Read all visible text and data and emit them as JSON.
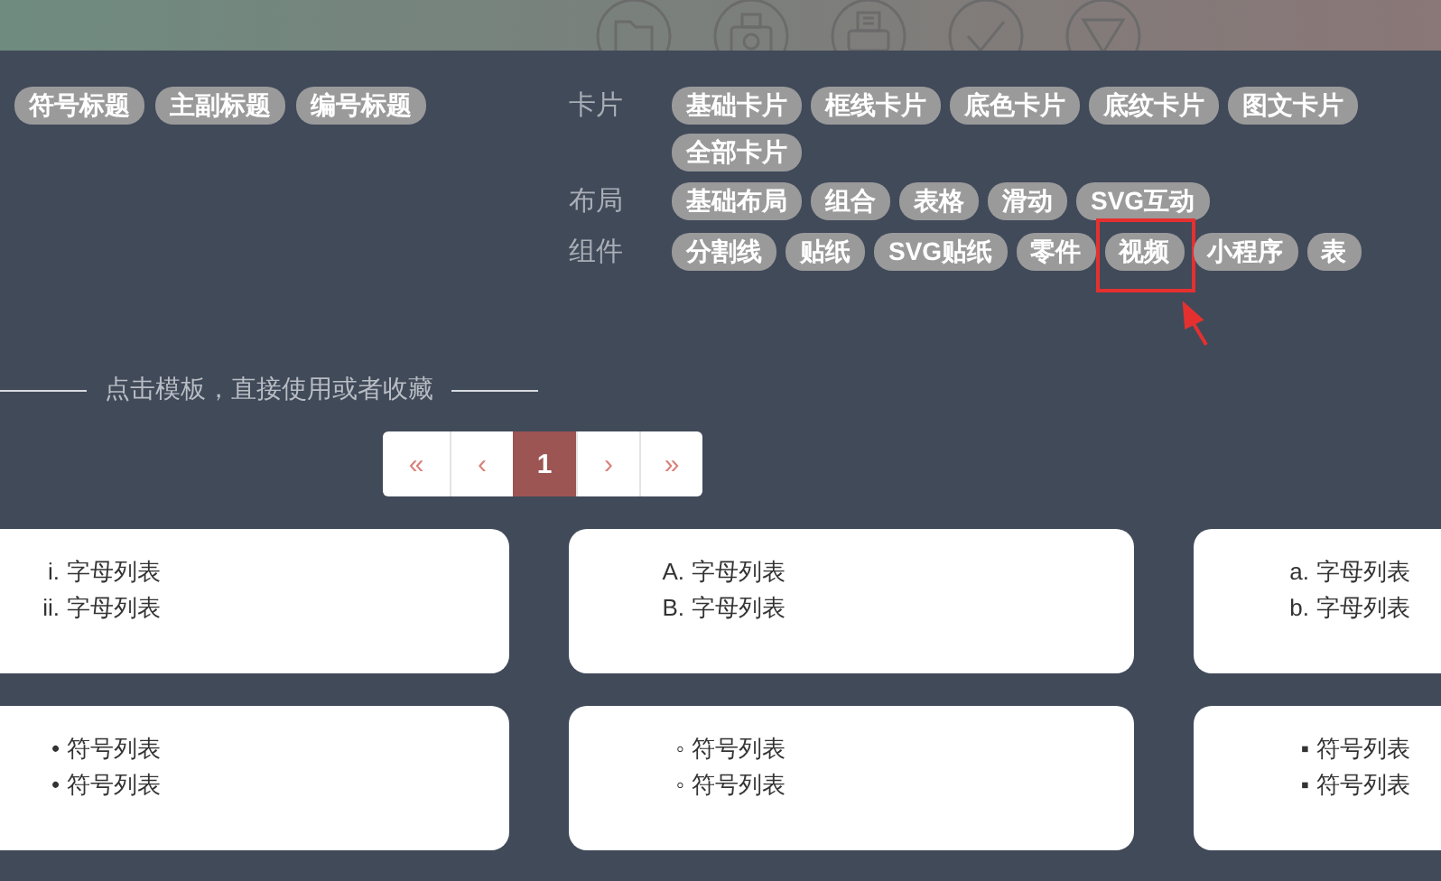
{
  "toolbar_icons": [
    {
      "kind": "folder"
    },
    {
      "kind": "camera"
    },
    {
      "kind": "printer"
    },
    {
      "kind": "check"
    },
    {
      "kind": "filter"
    }
  ],
  "title_tags": [
    "符号标题",
    "主副标题",
    "编号标题"
  ],
  "groups": [
    {
      "label": "卡片",
      "lines": [
        [
          {
            "text": "基础卡片",
            "highlighted": false
          },
          {
            "text": "框线卡片",
            "highlighted": false
          },
          {
            "text": "底色卡片",
            "highlighted": false
          },
          {
            "text": "底纹卡片",
            "highlighted": false
          },
          {
            "text": "图文卡片",
            "highlighted": false
          }
        ],
        [
          {
            "text": "全部卡片",
            "highlighted": false
          }
        ]
      ]
    },
    {
      "label": "布局",
      "lines": [
        [
          {
            "text": "基础布局",
            "highlighted": false
          },
          {
            "text": "组合",
            "highlighted": false
          },
          {
            "text": "表格",
            "highlighted": false
          },
          {
            "text": "滑动",
            "highlighted": false
          },
          {
            "text": "SVG互动",
            "highlighted": false
          }
        ]
      ]
    },
    {
      "label": "组件",
      "lines": [
        [
          {
            "text": "分割线",
            "highlighted": false
          },
          {
            "text": "贴纸",
            "highlighted": false
          },
          {
            "text": "SVG贴纸",
            "highlighted": false
          },
          {
            "text": "零件",
            "highlighted": false
          },
          {
            "text": "视频",
            "highlighted": true
          },
          {
            "text": "小程序",
            "highlighted": false
          },
          {
            "text": "表",
            "highlighted": false
          }
        ]
      ]
    }
  ],
  "divider_text": "点击模板，直接使用或者收藏",
  "pagination": [
    {
      "text": "«",
      "selected": false
    },
    {
      "text": "‹",
      "selected": false
    },
    {
      "text": "1",
      "selected": true
    },
    {
      "text": "›",
      "selected": false
    },
    {
      "text": "»",
      "selected": false
    }
  ],
  "cards": [
    {
      "items": [
        {
          "marker": "i.",
          "text": "字母列表"
        },
        {
          "marker": "ii.",
          "text": "字母列表"
        }
      ]
    },
    {
      "items": [
        {
          "marker": "A.",
          "text": "字母列表"
        },
        {
          "marker": "B.",
          "text": "字母列表"
        }
      ]
    },
    {
      "items": [
        {
          "marker": "a.",
          "text": "字母列表"
        },
        {
          "marker": "b.",
          "text": "字母列表"
        }
      ]
    },
    {
      "items": [
        {
          "marker": "•",
          "text": "符号列表"
        },
        {
          "marker": "•",
          "text": "符号列表"
        }
      ]
    },
    {
      "items": [
        {
          "marker": "◦",
          "text": "符号列表"
        },
        {
          "marker": "◦",
          "text": "符号列表"
        }
      ]
    },
    {
      "items": [
        {
          "marker": "▪",
          "text": "符号列表"
        },
        {
          "marker": "▪",
          "text": "符号列表"
        }
      ]
    }
  ]
}
